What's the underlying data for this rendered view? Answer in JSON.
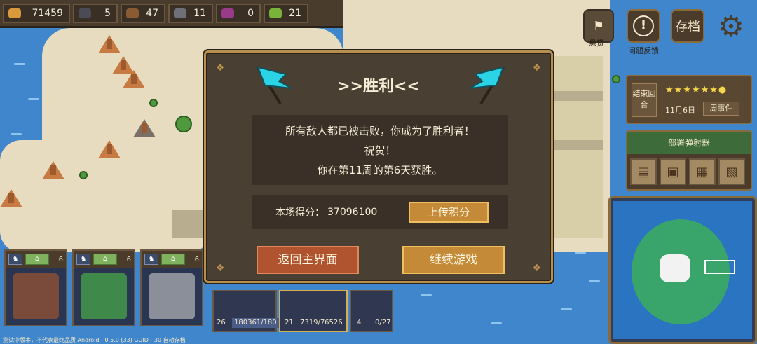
{
  "resources": [
    {
      "icon": "gold-ore-icon",
      "value": "71459",
      "color": "#d89a3a"
    },
    {
      "icon": "coal-icon",
      "value": "5",
      "color": "#4b4b55"
    },
    {
      "icon": "wood-icon",
      "value": "47",
      "color": "#8a5a32"
    },
    {
      "icon": "stone-icon",
      "value": "11",
      "color": "#6f6f7a"
    },
    {
      "icon": "crystal-icon",
      "value": "0",
      "color": "#9a3a8a"
    },
    {
      "icon": "herb-icon",
      "value": "21",
      "color": "#7ab33a"
    }
  ],
  "top_buttons": {
    "bounty_label": "悬赏",
    "feedback_label": "问题反馈",
    "save_label": "存档"
  },
  "turn": {
    "end_turn_label": "结束回合",
    "stars": "★★★★★★●",
    "date": "11月6日",
    "week_events_label": "周事件"
  },
  "deploy": {
    "title": "部署弹射器"
  },
  "buildings": [
    {
      "count": "6",
      "art_color": "#7a4a3a"
    },
    {
      "count": "6",
      "art_color": "#3f8a4a"
    },
    {
      "count": "6",
      "art_color": "#8a8f9a"
    }
  ],
  "units": [
    {
      "level": "26",
      "hp": "180361/180"
    },
    {
      "level": "21",
      "hp": "7319/76526"
    },
    {
      "level": "4",
      "hp": "0/27"
    }
  ],
  "footer": "测试中版本，不代表最终品质   Android - 0.5.0 (33)   GUID - 30   自动存档",
  "dialog": {
    "title": ">>胜利<<",
    "lines": [
      "所有敌人都已被击败，你成为了胜利者！",
      "祝贺！",
      "你在第11周的第6天获胜。"
    ],
    "score_label": "本场得分：",
    "score_value": "37096100",
    "upload_label": "上传积分",
    "back_label": "返回主界面",
    "continue_label": "继续游戏",
    "flag_color": "#2ad4e6"
  }
}
